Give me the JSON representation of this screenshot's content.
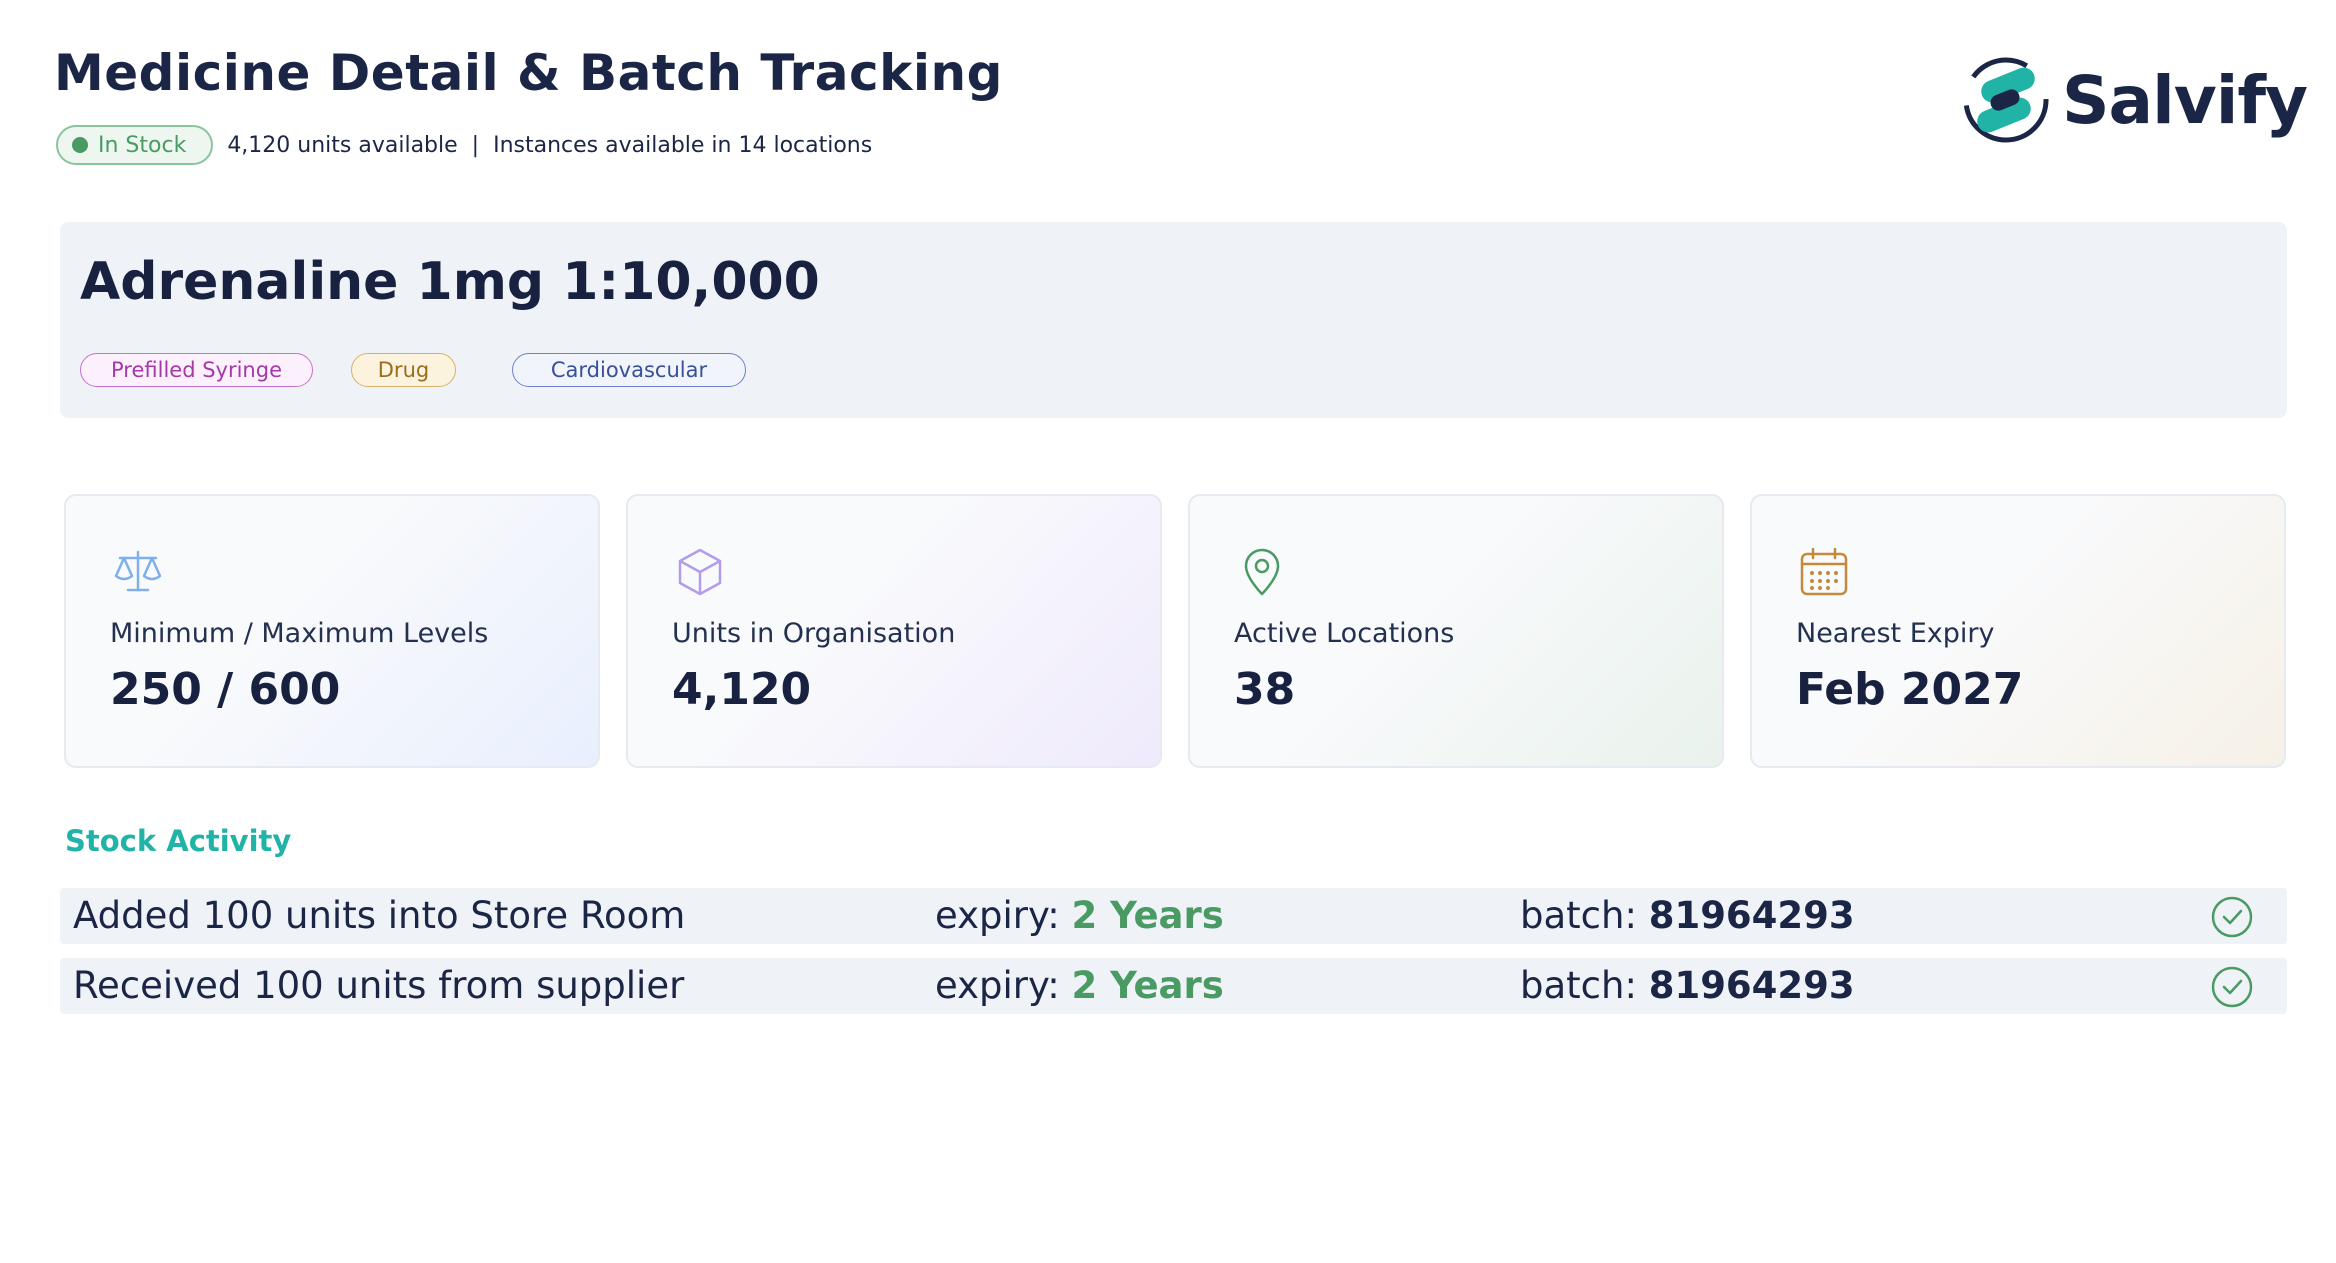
{
  "header": {
    "title": "Medicine Detail & Batch Tracking",
    "status_badge": "In Stock",
    "units_available": "4,120 units available",
    "separator": "|",
    "locations_text": "Instances available in 14 locations"
  },
  "logo": {
    "text": "Salvify",
    "icon": "salvify-logo-mark",
    "colors": {
      "mark_teal": "#20b3a6",
      "mark_navy": "#1b2545"
    }
  },
  "medicine": {
    "name": "Adrenaline 1mg 1:10,000",
    "tags": [
      {
        "label": "Prefilled Syringe",
        "color": "#a33aa8"
      },
      {
        "label": "Drug",
        "color": "#9a6d1b"
      },
      {
        "label": "Cardiovascular",
        "color": "#38509a"
      }
    ]
  },
  "stats": [
    {
      "icon": "scale-icon",
      "label": "Minimum / Maximum Levels",
      "value": "250 / 600",
      "icon_color": "#7fb0ec"
    },
    {
      "icon": "box-icon",
      "label": "Units in Organisation",
      "value": "4,120",
      "icon_color": "#b39cec"
    },
    {
      "icon": "location-pin-icon",
      "label": "Active Locations",
      "value": "38",
      "icon_color": "#4a9a64"
    },
    {
      "icon": "calendar-icon",
      "label": "Nearest Expiry",
      "value": "Feb 2027",
      "icon_color": "#c48a3a"
    }
  ],
  "activity": {
    "title": "Stock Activity",
    "expiry_label": "expiry:",
    "batch_label": "batch:",
    "rows": [
      {
        "description": "Added 100 units into Store Room",
        "expiry": "2 Years",
        "batch": "81964293",
        "status_icon": "check-circle-icon"
      },
      {
        "description": "Received 100 units from supplier",
        "expiry": "2 Years",
        "batch": "81964293",
        "status_icon": "check-circle-icon"
      }
    ]
  },
  "colors": {
    "accent_teal": "#20b3a6",
    "success_green": "#4a9a64",
    "text_navy": "#1b2545",
    "panel_bg": "#eff2f7"
  }
}
